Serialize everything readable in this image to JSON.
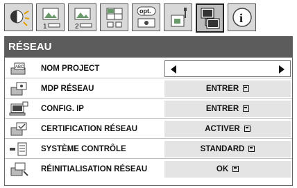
{
  "tabs": [
    {
      "icon": "image-adjust-icon",
      "text": ""
    },
    {
      "icon": "image-1-icon",
      "text": "1"
    },
    {
      "icon": "image-2-icon",
      "text": "2"
    },
    {
      "icon": "display-settings-icon",
      "text": ""
    },
    {
      "icon": "option-icon",
      "text": "opt."
    },
    {
      "icon": "setup-icon",
      "text": ""
    },
    {
      "icon": "network-icon",
      "text": "",
      "active": true
    },
    {
      "icon": "info-icon",
      "text": "i"
    }
  ],
  "header": {
    "title": "RÉSEAU"
  },
  "rows": [
    {
      "icon": "project-name-icon",
      "label": "NOM PROJECT",
      "value": "",
      "selected": true
    },
    {
      "icon": "network-password-icon",
      "label": "MDP RÉSEAU",
      "value": "ENTRER"
    },
    {
      "icon": "ip-config-icon",
      "label": "CONFIG. IP",
      "value": "ENTRER"
    },
    {
      "icon": "network-certification-icon",
      "label": "CERTIFICATION RÉSEAU",
      "value": "ACTIVER"
    },
    {
      "icon": "control-system-icon",
      "label": "SYSTÈME CONTRÔLE",
      "value": "STANDARD"
    },
    {
      "icon": "network-reset-icon",
      "label": "RÉINITIALISATION RÉSEAU",
      "value": "OK"
    }
  ]
}
